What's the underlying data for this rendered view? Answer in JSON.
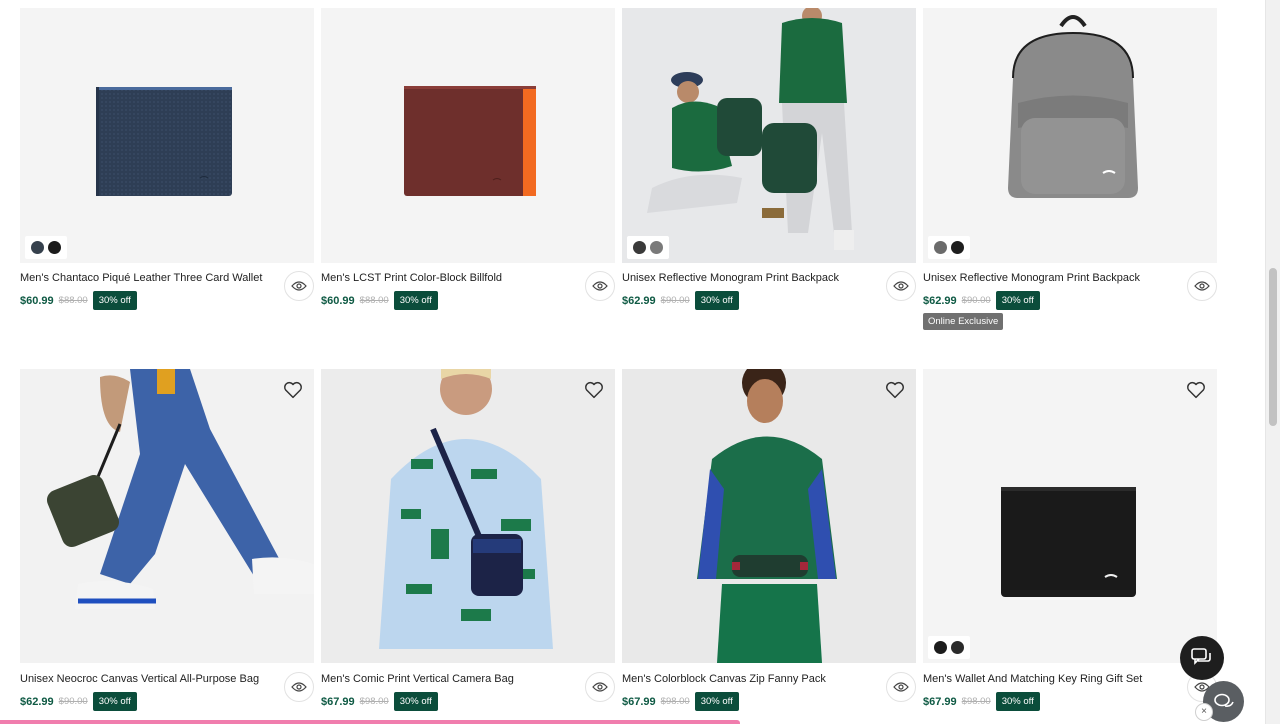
{
  "products": [
    {
      "name": "Men's Chantaco Piqué Leather Three Card Wallet",
      "price": "$60.99",
      "old_price": "$88.00",
      "discount": "30% off",
      "swatches": [
        "#36414d",
        "#1c1c1c"
      ]
    },
    {
      "name": "Men's LCST Print Color-Block Billfold",
      "price": "$60.99",
      "old_price": "$88.00",
      "discount": "30% off"
    },
    {
      "name": "Unisex Reflective Monogram Print Backpack",
      "price": "$62.99",
      "old_price": "$90.00",
      "discount": "30% off",
      "swatches": [
        "#3a3a3a",
        "#7a7a7a"
      ]
    },
    {
      "name": "Unisex Reflective Monogram Print Backpack",
      "price": "$62.99",
      "old_price": "$90.00",
      "discount": "30% off",
      "swatches": [
        "#6b6b6b",
        "#1e1e1e"
      ],
      "tag": "Online Exclusive"
    },
    {
      "name": "Unisex Neocroc Canvas Vertical All-Purpose Bag",
      "price": "$62.99",
      "old_price": "$90.00",
      "discount": "30% off"
    },
    {
      "name": "Men's Comic Print Vertical Camera Bag",
      "price": "$67.99",
      "old_price": "$98.00",
      "discount": "30% off"
    },
    {
      "name": "Men's Colorblock Canvas Zip Fanny Pack",
      "price": "$67.99",
      "old_price": "$98.00",
      "discount": "30% off"
    },
    {
      "name": "Men's Wallet And Matching Key Ring Gift Set",
      "price": "$67.99",
      "old_price": "$98.00",
      "discount": "30% off",
      "swatches": [
        "#1c1c1c",
        "#2b2b2b"
      ]
    }
  ],
  "icons": {
    "wishlist": "heart-icon",
    "quick_view": "eye-icon",
    "chat": "chat-icon",
    "close": "×"
  },
  "colors": {
    "price": "#0f5a44",
    "badge": "#0b4d3b",
    "exclusive_badge": "#707070"
  }
}
